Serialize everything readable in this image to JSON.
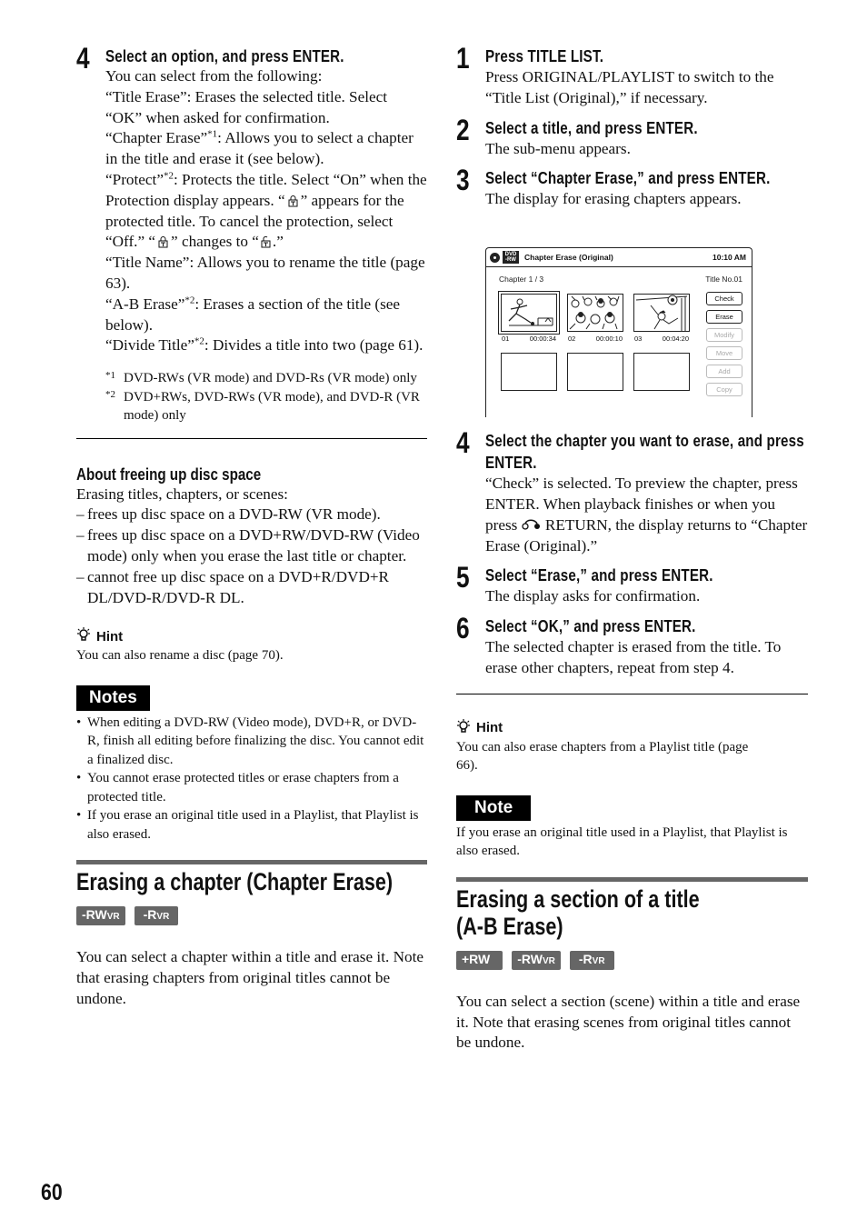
{
  "page_number": "60",
  "left": {
    "step4": {
      "num": "4",
      "head": "Select an option, and press ENTER.",
      "lines": [
        "You can select from the following:",
        "“Title Erase”: Erases the selected title. Select “OK” when asked for confirmation.",
        "“Chapter Erase”",
        "*1",
        ": Allows you to select a chapter in the title and erase it (see below).",
        "“Protect”",
        "*2",
        ": Protects the title. Select “On” when the Protection display appears. “",
        "” appears for the protected title. To cancel the protection, select “Off.” “",
        "” changes to “",
        ".”",
        "“Title Name”: Allows you to rename the title (page 63).",
        "“A-B Erase”",
        "*2",
        ": Erases a section of the title (see below).",
        "“Divide Title”",
        "*2",
        ": Divides a title into two (page 61)."
      ]
    },
    "footnotes": [
      {
        "mark": "*1",
        "text": "DVD-RWs (VR mode) and DVD-Rs (VR mode) only"
      },
      {
        "mark": "*2",
        "text": "DVD+RWs, DVD-RWs (VR mode), and DVD-R (VR mode) only"
      }
    ],
    "about": {
      "title": "About freeing up disc space",
      "intro": "Erasing titles, chapters, or scenes:",
      "items": [
        "frees up disc space on a DVD-RW (VR mode).",
        "frees up disc space on a DVD+RW/DVD-RW (Video mode) only when you erase the last title or chapter.",
        "cannot free up disc space on a DVD+R/DVD+R DL/DVD-R/DVD-R DL."
      ]
    },
    "hint": {
      "label": "Hint",
      "text": "You can also rename a disc (page 70)."
    },
    "notes": {
      "label": "Notes",
      "items": [
        "When editing a DVD-RW (Video mode), DVD+R, or DVD-R, finish all editing before finalizing the disc. You cannot edit a finalized disc.",
        "You cannot erase protected titles or erase chapters from a protected title.",
        "If you erase an original title used in a Playlist, that Playlist is also erased."
      ]
    },
    "section": {
      "title": "Erasing a chapter (Chapter Erase)",
      "badges": [
        {
          "main": "-RW",
          "sub": "VR"
        },
        {
          "main": "-R",
          "sub": "VR"
        }
      ],
      "text": "You can select a chapter within a title and erase it. Note that erasing chapters from original titles cannot be undone."
    }
  },
  "right": {
    "steps": [
      {
        "num": "1",
        "head": "Press TITLE LIST.",
        "body": "Press ORIGINAL/PLAYLIST to switch to the “Title List (Original),” if necessary."
      },
      {
        "num": "2",
        "head": "Select a title, and press ENTER.",
        "body": "The sub-menu appears."
      },
      {
        "num": "3",
        "head": "Select “Chapter Erase,” and press ENTER.",
        "body": "The display for erasing chapters appears."
      },
      {
        "num": "4",
        "head": "Select the chapter you want to erase, and press ENTER.",
        "body_a": "“Check” is selected. To preview the chapter, press ENTER. When playback finishes or when you press ",
        "body_b": " RETURN, the display returns to “Chapter Erase (Original).”"
      },
      {
        "num": "5",
        "head": "Select “Erase,” and press ENTER.",
        "body": "The display asks for confirmation."
      },
      {
        "num": "6",
        "head": "Select “OK,” and press ENTER.",
        "body": "The selected chapter is erased from the title. To erase other chapters, repeat from step 4."
      }
    ],
    "screen": {
      "disc_label": "DVD -RW",
      "title": "Chapter Erase (Original)",
      "time": "10:10 AM",
      "chapter": "Chapter 1 / 3",
      "title_no": "Title No.01",
      "thumbs": [
        {
          "num": "01",
          "time": "00:00:34",
          "selected": true
        },
        {
          "num": "02",
          "time": "00:00:10",
          "selected": false
        },
        {
          "num": "03",
          "time": "00:04:20",
          "selected": false
        }
      ],
      "buttons": [
        {
          "label": "Check",
          "enabled": true
        },
        {
          "label": "Erase",
          "enabled": true
        },
        {
          "label": "Modify",
          "enabled": false
        },
        {
          "label": "Move",
          "enabled": false
        },
        {
          "label": "Add",
          "enabled": false
        },
        {
          "label": "Copy",
          "enabled": false
        }
      ]
    },
    "hint": {
      "label": "Hint",
      "text": "You can also erase chapters from a Playlist title (page 66)."
    },
    "note": {
      "label": "Note",
      "text": "If you erase an original title used in a Playlist, that Playlist is also erased."
    },
    "section": {
      "title_line1": "Erasing a section of a title",
      "title_line2": "(A-B Erase)",
      "badges": [
        {
          "main": "+RW",
          "sub": ""
        },
        {
          "main": "-RW",
          "sub": "VR"
        },
        {
          "main": "-R",
          "sub": "VR"
        }
      ],
      "text": "You can select a section (scene) within a title and erase it. Note that erasing scenes from original titles cannot be undone."
    }
  }
}
